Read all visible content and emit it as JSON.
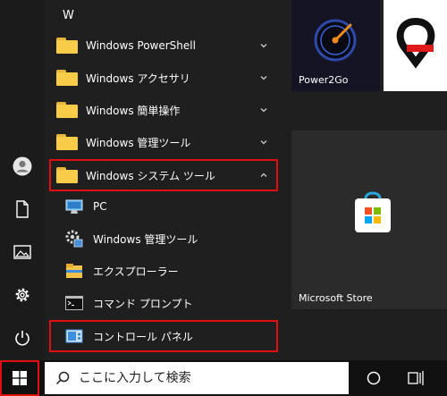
{
  "start_menu": {
    "section_letter": "W",
    "folders": [
      {
        "label": "Windows PowerShell",
        "expanded": false
      },
      {
        "label": "Windows アクセサリ",
        "expanded": false
      },
      {
        "label": "Windows 簡単操作",
        "expanded": false
      },
      {
        "label": "Windows 管理ツール",
        "expanded": false
      },
      {
        "label": "Windows システム ツール",
        "expanded": true
      }
    ],
    "system_tools_items": [
      {
        "label": "PC",
        "icon": "pc-icon"
      },
      {
        "label": "Windows 管理ツール",
        "icon": "admin-tools-icon"
      },
      {
        "label": "エクスプローラー",
        "icon": "file-explorer-icon"
      },
      {
        "label": "コマンド プロンプト",
        "icon": "command-prompt-icon"
      },
      {
        "label": "コントロール パネル",
        "icon": "control-panel-icon"
      }
    ],
    "tiles": [
      {
        "label": "Power2Go",
        "icon": "power2go-icon"
      },
      {
        "label": "",
        "icon": "app-logo-icon"
      },
      {
        "label": "Microsoft Store",
        "icon": "microsoft-store-icon"
      }
    ]
  },
  "taskbar": {
    "search_placeholder": "ここに入力して検索"
  },
  "colors": {
    "highlight": "#e01010",
    "folder": "#f8cc49",
    "store_tile": "#2b2b2b",
    "power2go_tile": "#1a1a2a"
  }
}
